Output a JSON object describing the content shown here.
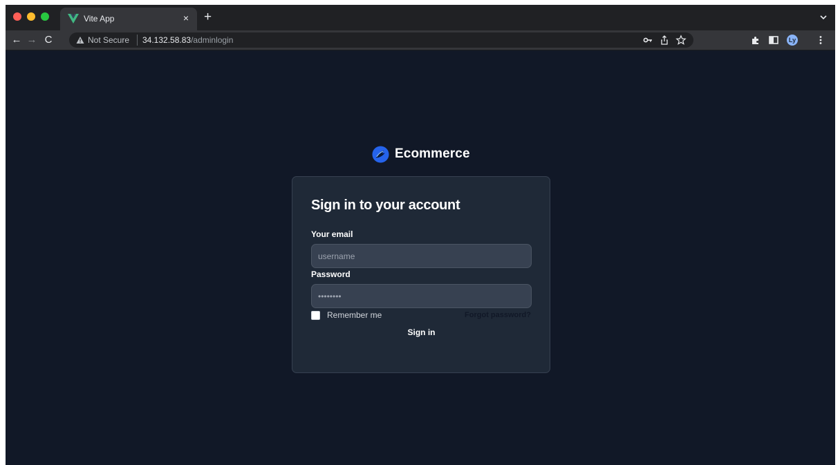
{
  "browser": {
    "tab": {
      "title": "Vite App",
      "close": "×"
    },
    "new_tab": "+",
    "nav": {
      "back": "←",
      "forward": "→",
      "reload": "C"
    },
    "address": {
      "security_label": "Not Secure",
      "url_host": "34.132.58.83",
      "url_path": "/adminlogin"
    },
    "profile_initials": "Ly"
  },
  "page": {
    "brand": {
      "name": "Ecommerce"
    },
    "login": {
      "title": "Sign in to your account",
      "email_label": "Your email",
      "email_placeholder": "username",
      "password_label": "Password",
      "password_placeholder": "••••••••",
      "remember_label": "Remember me",
      "forgot_link": "Forgot password?",
      "submit_label": "Sign in"
    }
  },
  "colors": {
    "page_background": "#111827",
    "card_background": "#1f2937",
    "input_background": "#374151",
    "brand_logo": "#2563eb"
  }
}
